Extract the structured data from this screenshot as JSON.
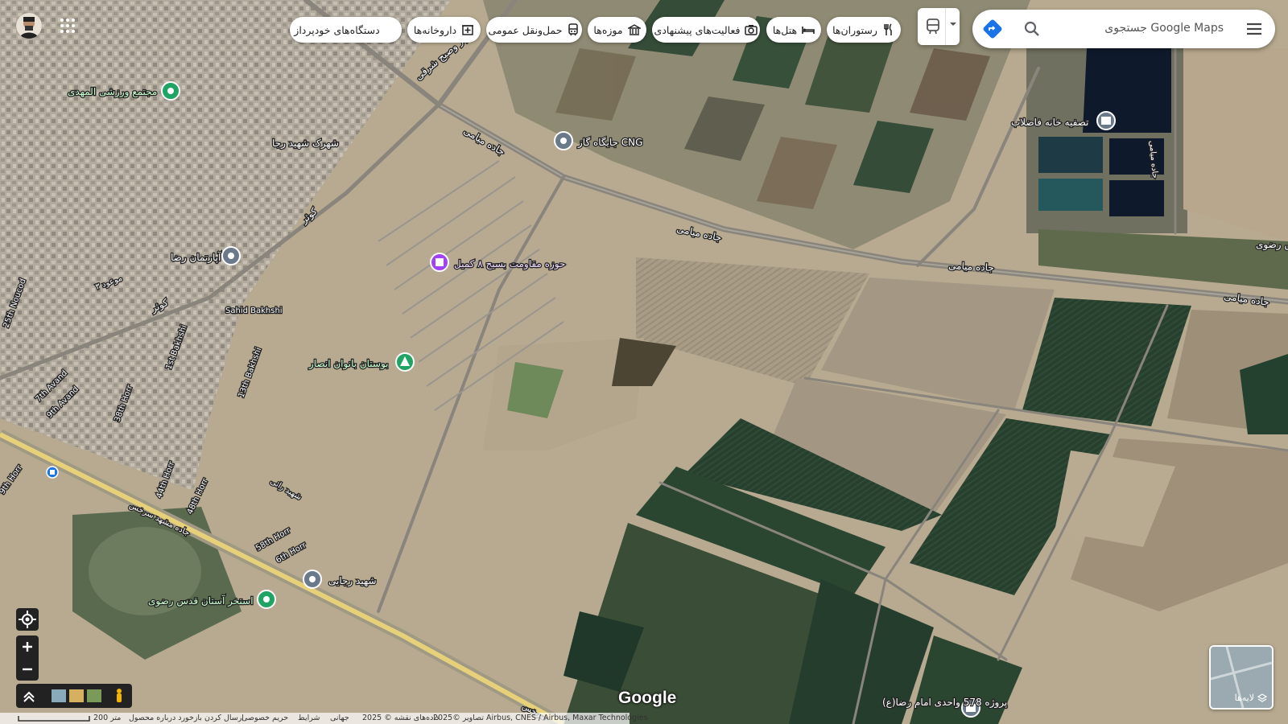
{
  "search": {
    "placeholder": "جستجوی Google Maps"
  },
  "chips": [
    {
      "label": "رستوران‌ها",
      "icon": "restaurant-icon"
    },
    {
      "label": "هتل‌ها",
      "icon": "hotel-icon"
    },
    {
      "label": "فعالیت‌های پیشنهادی",
      "icon": "camera-icon"
    },
    {
      "label": "موزه‌ها",
      "icon": "museum-icon"
    },
    {
      "label": "حمل‌ونقل عمومی",
      "icon": "transit-icon"
    },
    {
      "label": "داروخانه‌ها",
      "icon": "pharmacy-icon"
    },
    {
      "label": "دستگاه‌های خودپرداز",
      "icon": "atm-icon"
    }
  ],
  "places": {
    "sport_complex": "مجتمع ورزشی المهدی",
    "shahrak": "شهرک شهید رجا",
    "cng": "جایگاه گاز CNG",
    "water": "تصفیه خانه فاضلاب",
    "apartment": "آپارتمان رضا",
    "basij": "حوزه مقاومت بسیج ۸ کمیل",
    "park": "بوستان بانوان انصار",
    "shahid_rajaei": "شهید رجایی",
    "pool": "استخر آستان قدس رضوی",
    "project": "پروژه 578 واحدی امام رضا(ع)"
  },
  "roads": {
    "miami1": "جاده میامی",
    "miami2": "جاده میامی",
    "miami3": "جاده میامی",
    "miami4": "جاده میامی",
    "kowsar1": "کوثر",
    "kowsar2": "کوثر",
    "blvd": "بلوار وصیح شرقی",
    "mashhad_sarakhs": "جاده مشهد سرخس",
    "sarakhs_end": "سرخس",
    "razavi": "س رضوی",
    "sahid_bakhshi": "Sahid Bakhshi",
    "nouced": "25th Noucod",
    "mowood": "موعود ۳",
    "bakhshi1": "1st Bakhshi",
    "bakhshi13": "13th Bakhshi",
    "avand9": "9th Avand",
    "avand7": "7th Avand",
    "horr38": "38th Horr",
    "horr44": "44th Horr",
    "horr48": "48th Horr",
    "horr58": "58th Horr",
    "horr6": "6th Horr",
    "horr9": "9th Horr",
    "raaee": "شهید رائی",
    "jami": "جاده میامی"
  },
  "bottom": {
    "imagery": "تصاویر ©2025 Airbus, CNES / Airbus, Maxar Technologies",
    "mapdata": "داده‌های نقشه © 2025",
    "world": "جهانی",
    "terms": "شرایط",
    "privacy": "حریم خصوصی",
    "feedback": "ارسال کردن بازخورد درباره محصول",
    "scale": "200 متر"
  },
  "layers_label": "لایه‌ها",
  "brand": "Google"
}
